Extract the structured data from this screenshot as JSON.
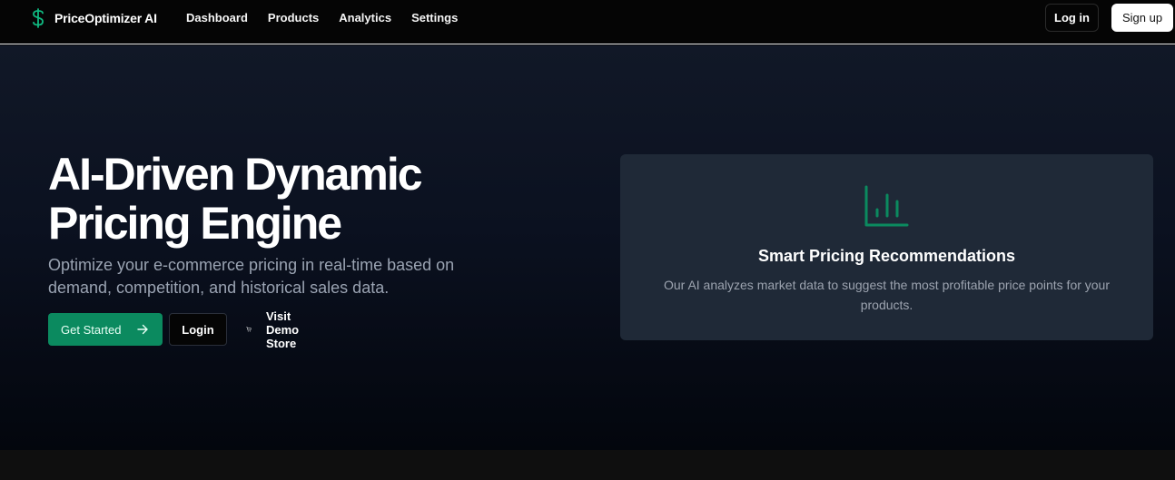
{
  "nav": {
    "brand_icon": "dollar-sign-icon",
    "brand_name": "PriceOptimizer AI",
    "links": [
      "Dashboard",
      "Products",
      "Analytics",
      "Settings"
    ],
    "login_label": "Log in",
    "signup_label": "Sign up"
  },
  "hero": {
    "title_line1": "AI-Driven Dynamic",
    "title_line2": "Pricing Engine",
    "subtitle": "Optimize your e-commerce pricing in real-time based on demand, competition, and historical sales data.",
    "primary_label": "Get Started",
    "primary_icon": "arrow-right-icon",
    "secondary_label": "Login",
    "demo_label": "Visit Demo Store",
    "demo_icon": "shopping-cart-icon"
  },
  "card": {
    "icon": "bar-chart-icon",
    "title": "Smart Pricing Recommendations",
    "description": "Our AI analyzes market data to suggest the most profitable price points for your products."
  },
  "colors": {
    "accent": "#0b8a5f",
    "hero_bg_top": "#111827",
    "card_bg": "#1f2937",
    "muted_text": "#9ca3af"
  }
}
